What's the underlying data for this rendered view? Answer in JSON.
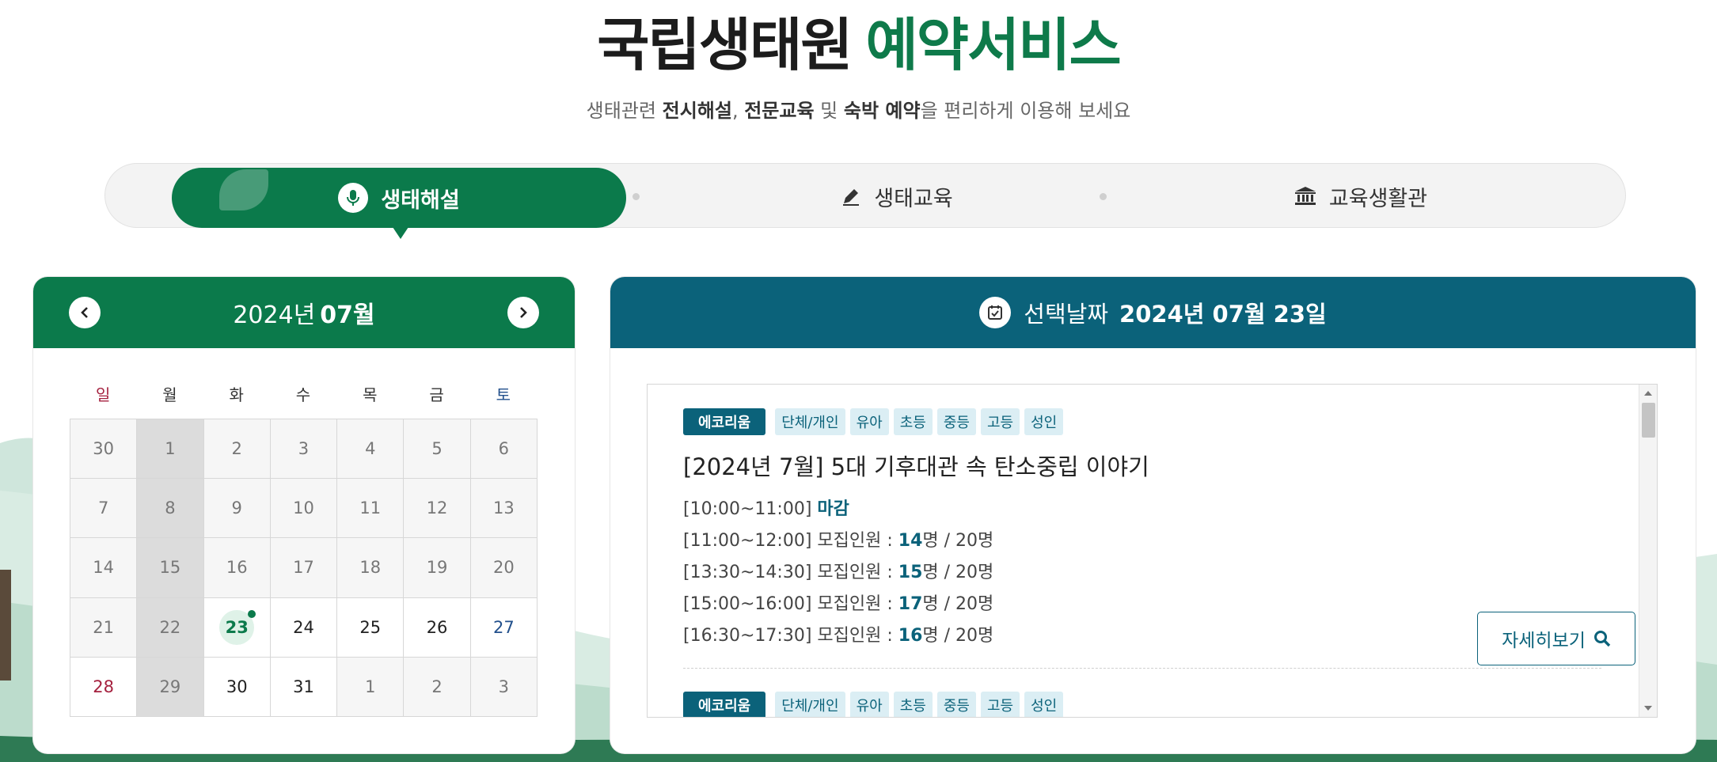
{
  "header": {
    "title_part1": "국립생태원",
    "title_part2": "예약서비스",
    "subtitle_pre": "생태관련 ",
    "subtitle_b1": "전시해설",
    "subtitle_sep1": ", ",
    "subtitle_b2": "전문교육",
    "subtitle_sep2": " 및 ",
    "subtitle_b3": "숙박 예약",
    "subtitle_post": "을 편리하게 이용해 보세요"
  },
  "tabs": [
    {
      "label": "생태해설",
      "icon": "microphone-icon",
      "active": true
    },
    {
      "label": "생태교육",
      "icon": "pencil-icon",
      "active": false
    },
    {
      "label": "교육생활관",
      "icon": "institution-icon",
      "active": false
    }
  ],
  "calendar": {
    "year_label": "2024년",
    "month_label": "07월",
    "weekdays": [
      "일",
      "월",
      "화",
      "수",
      "목",
      "금",
      "토"
    ],
    "weeks": [
      [
        "30",
        "1",
        "2",
        "3",
        "4",
        "5",
        "6"
      ],
      [
        "7",
        "8",
        "9",
        "10",
        "11",
        "12",
        "13"
      ],
      [
        "14",
        "15",
        "16",
        "17",
        "18",
        "19",
        "20"
      ],
      [
        "21",
        "22",
        "23",
        "24",
        "25",
        "26",
        "27"
      ],
      [
        "28",
        "29",
        "30",
        "31",
        "1",
        "2",
        "3"
      ]
    ],
    "selected_day": "23"
  },
  "detail": {
    "header_label": "선택날짜",
    "selected_date": "2024년 07월 23일",
    "items": [
      {
        "category": "에코리움",
        "tags": [
          "단체/개인",
          "유아",
          "초등",
          "중등",
          "고등",
          "성인"
        ],
        "title": "[2024년 7월] 5대 기후대관 속 탄소중립 이야기",
        "slots": [
          {
            "time": "[10:00~11:00]",
            "label": "",
            "count": "",
            "closed": "마감",
            "total": ""
          },
          {
            "time": "[11:00~12:00]",
            "label": "모집인원 :",
            "count": "14",
            "closed": "",
            "total": "명 / 20명"
          },
          {
            "time": "[13:30~14:30]",
            "label": "모집인원 :",
            "count": "15",
            "closed": "",
            "total": "명 / 20명"
          },
          {
            "time": "[15:00~16:00]",
            "label": "모집인원 :",
            "count": "17",
            "closed": "",
            "total": "명 / 20명"
          },
          {
            "time": "[16:30~17:30]",
            "label": "모집인원 :",
            "count": "16",
            "closed": "",
            "total": "명 / 20명"
          }
        ],
        "button_label": "자세히보기"
      },
      {
        "category": "에코리움",
        "tags": [
          "단체/개인",
          "유아",
          "초등",
          "중등",
          "고등",
          "성인"
        ]
      }
    ]
  },
  "colors": {
    "green": "#0b7a4b",
    "teal": "#0b627a",
    "sunday": "#a5213f",
    "saturday": "#22508c"
  }
}
